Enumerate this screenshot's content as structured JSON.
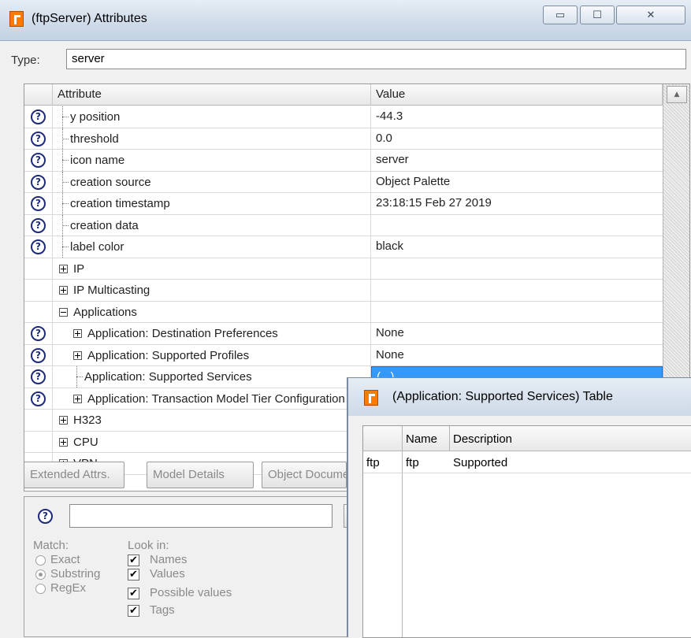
{
  "window": {
    "title": "(ftpServer) Attributes",
    "minimize_symbol": "▭",
    "maximize_symbol": "☐",
    "close_symbol": "✕"
  },
  "type_field": {
    "label": "Type:",
    "value": "server"
  },
  "grid": {
    "header_attribute": "Attribute",
    "header_value": "Value",
    "scroll_up_symbol": "▲",
    "rows": [
      {
        "attr": "y position",
        "value": "-44.3"
      },
      {
        "attr": "threshold",
        "value": "0.0"
      },
      {
        "attr": "icon name",
        "value": "server"
      },
      {
        "attr": "creation source",
        "value": "Object Palette"
      },
      {
        "attr": "creation timestamp",
        "value": "23:18:15 Feb 27 2019"
      },
      {
        "attr": "creation data",
        "value": ""
      },
      {
        "attr": "label color",
        "value": "black"
      },
      {
        "attr": "IP",
        "value": ""
      },
      {
        "attr": "IP Multicasting",
        "value": ""
      },
      {
        "attr": "Applications",
        "value": ""
      },
      {
        "attr": "Application: Destination Preferences",
        "value": "None"
      },
      {
        "attr": "Application: Supported Profiles",
        "value": "None"
      },
      {
        "attr": "Application: Supported Services",
        "value": "(...)"
      },
      {
        "attr": "Application: Transaction Model Tier Configuration",
        "value": ""
      },
      {
        "attr": "H323",
        "value": ""
      },
      {
        "attr": "CPU",
        "value": ""
      },
      {
        "attr": "VPN",
        "value": ""
      }
    ]
  },
  "buttons": {
    "extended_attrs": "Extended Attrs.",
    "model_details": "Model Details",
    "object_doc": "Object Documentation"
  },
  "search": {
    "query": "",
    "help_symbol": "?",
    "match_label": "Match:",
    "match_options": [
      "Exact",
      "Substring",
      "RegEx"
    ],
    "look_in_label": "Look in:",
    "look_in_options": [
      "Names",
      "Values",
      "Possible values",
      "Tags"
    ],
    "check_symbol": "✔"
  },
  "sub_window": {
    "title": "(Application: Supported Services) Table",
    "col_name": "Name",
    "col_description": "Description",
    "rows": [
      {
        "row_label": "ftp",
        "name": "ftp",
        "description": "Supported"
      }
    ]
  }
}
